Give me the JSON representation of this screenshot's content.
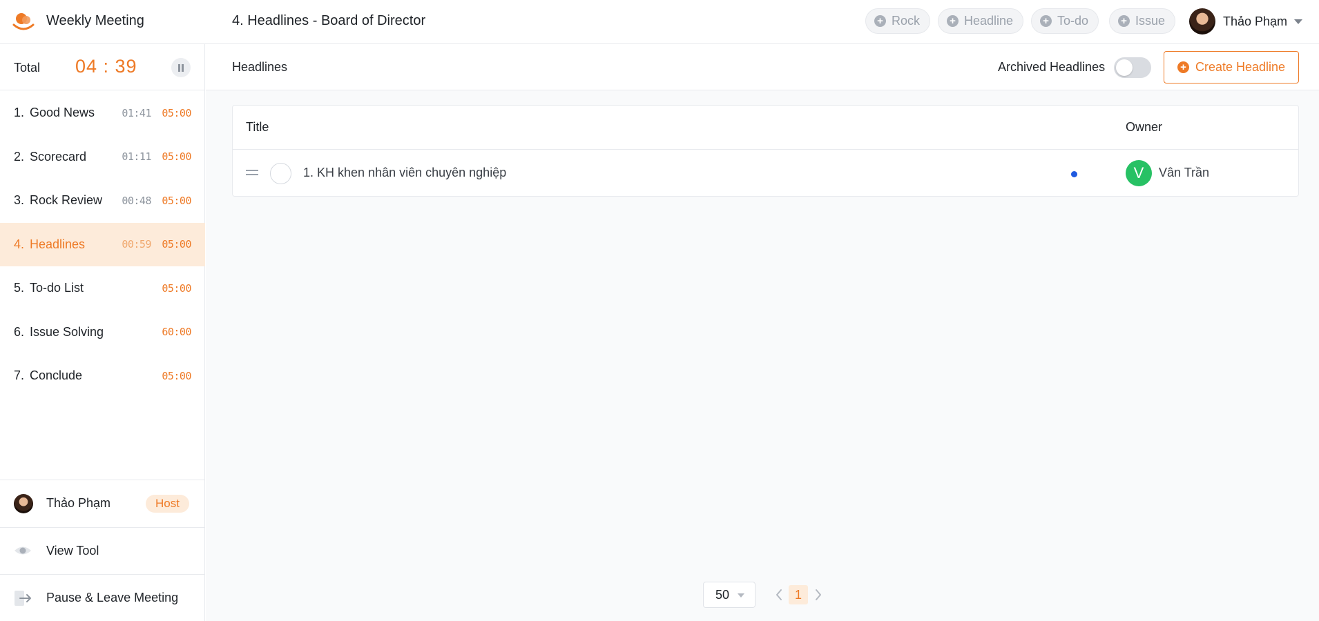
{
  "header": {
    "app_title": "Weekly Meeting",
    "page_title": "4. Headlines - Board of Director",
    "quick_add": [
      {
        "label": "Rock"
      },
      {
        "label": "Headline"
      },
      {
        "label": "To-do"
      },
      {
        "label": "Issue"
      }
    ],
    "user_name": "Thảo Phạm"
  },
  "sidebar": {
    "total_label": "Total",
    "total_time": "04 : 39",
    "agenda": [
      {
        "index": "1.",
        "title": "Good News",
        "elapsed": "01:41",
        "limit": "05:00"
      },
      {
        "index": "2.",
        "title": "Scorecard",
        "elapsed": "01:11",
        "limit": "05:00"
      },
      {
        "index": "3.",
        "title": "Rock Review",
        "elapsed": "00:48",
        "limit": "05:00"
      },
      {
        "index": "4.",
        "title": "Headlines",
        "elapsed": "00:59",
        "limit": "05:00"
      },
      {
        "index": "5.",
        "title": "To-do List",
        "elapsed": "",
        "limit": "05:00"
      },
      {
        "index": "6.",
        "title": "Issue Solving",
        "elapsed": "",
        "limit": "60:00"
      },
      {
        "index": "7.",
        "title": "Conclude",
        "elapsed": "",
        "limit": "05:00"
      }
    ],
    "active_index": 3,
    "host_name": "Thảo Phạm",
    "host_badge": "Host",
    "view_tool": "View Tool",
    "leave": "Pause & Leave Meeting"
  },
  "main": {
    "section_title": "Headlines",
    "archived_label": "Archived Headlines",
    "archived_on": false,
    "create_label": "Create Headline",
    "columns": {
      "title": "Title",
      "owner": "Owner"
    },
    "rows": [
      {
        "title": "1. KH khen nhân viên chuyên nghiệp",
        "owner_initial": "V",
        "owner_name": "Vân Trần"
      }
    ],
    "pager": {
      "page_size": "50",
      "current_page": "1"
    }
  },
  "colors": {
    "accent": "#ee7a26",
    "accent_light": "#fdebda",
    "owner_avatar": "#27c164",
    "status_dot": "#1f5ae0"
  }
}
